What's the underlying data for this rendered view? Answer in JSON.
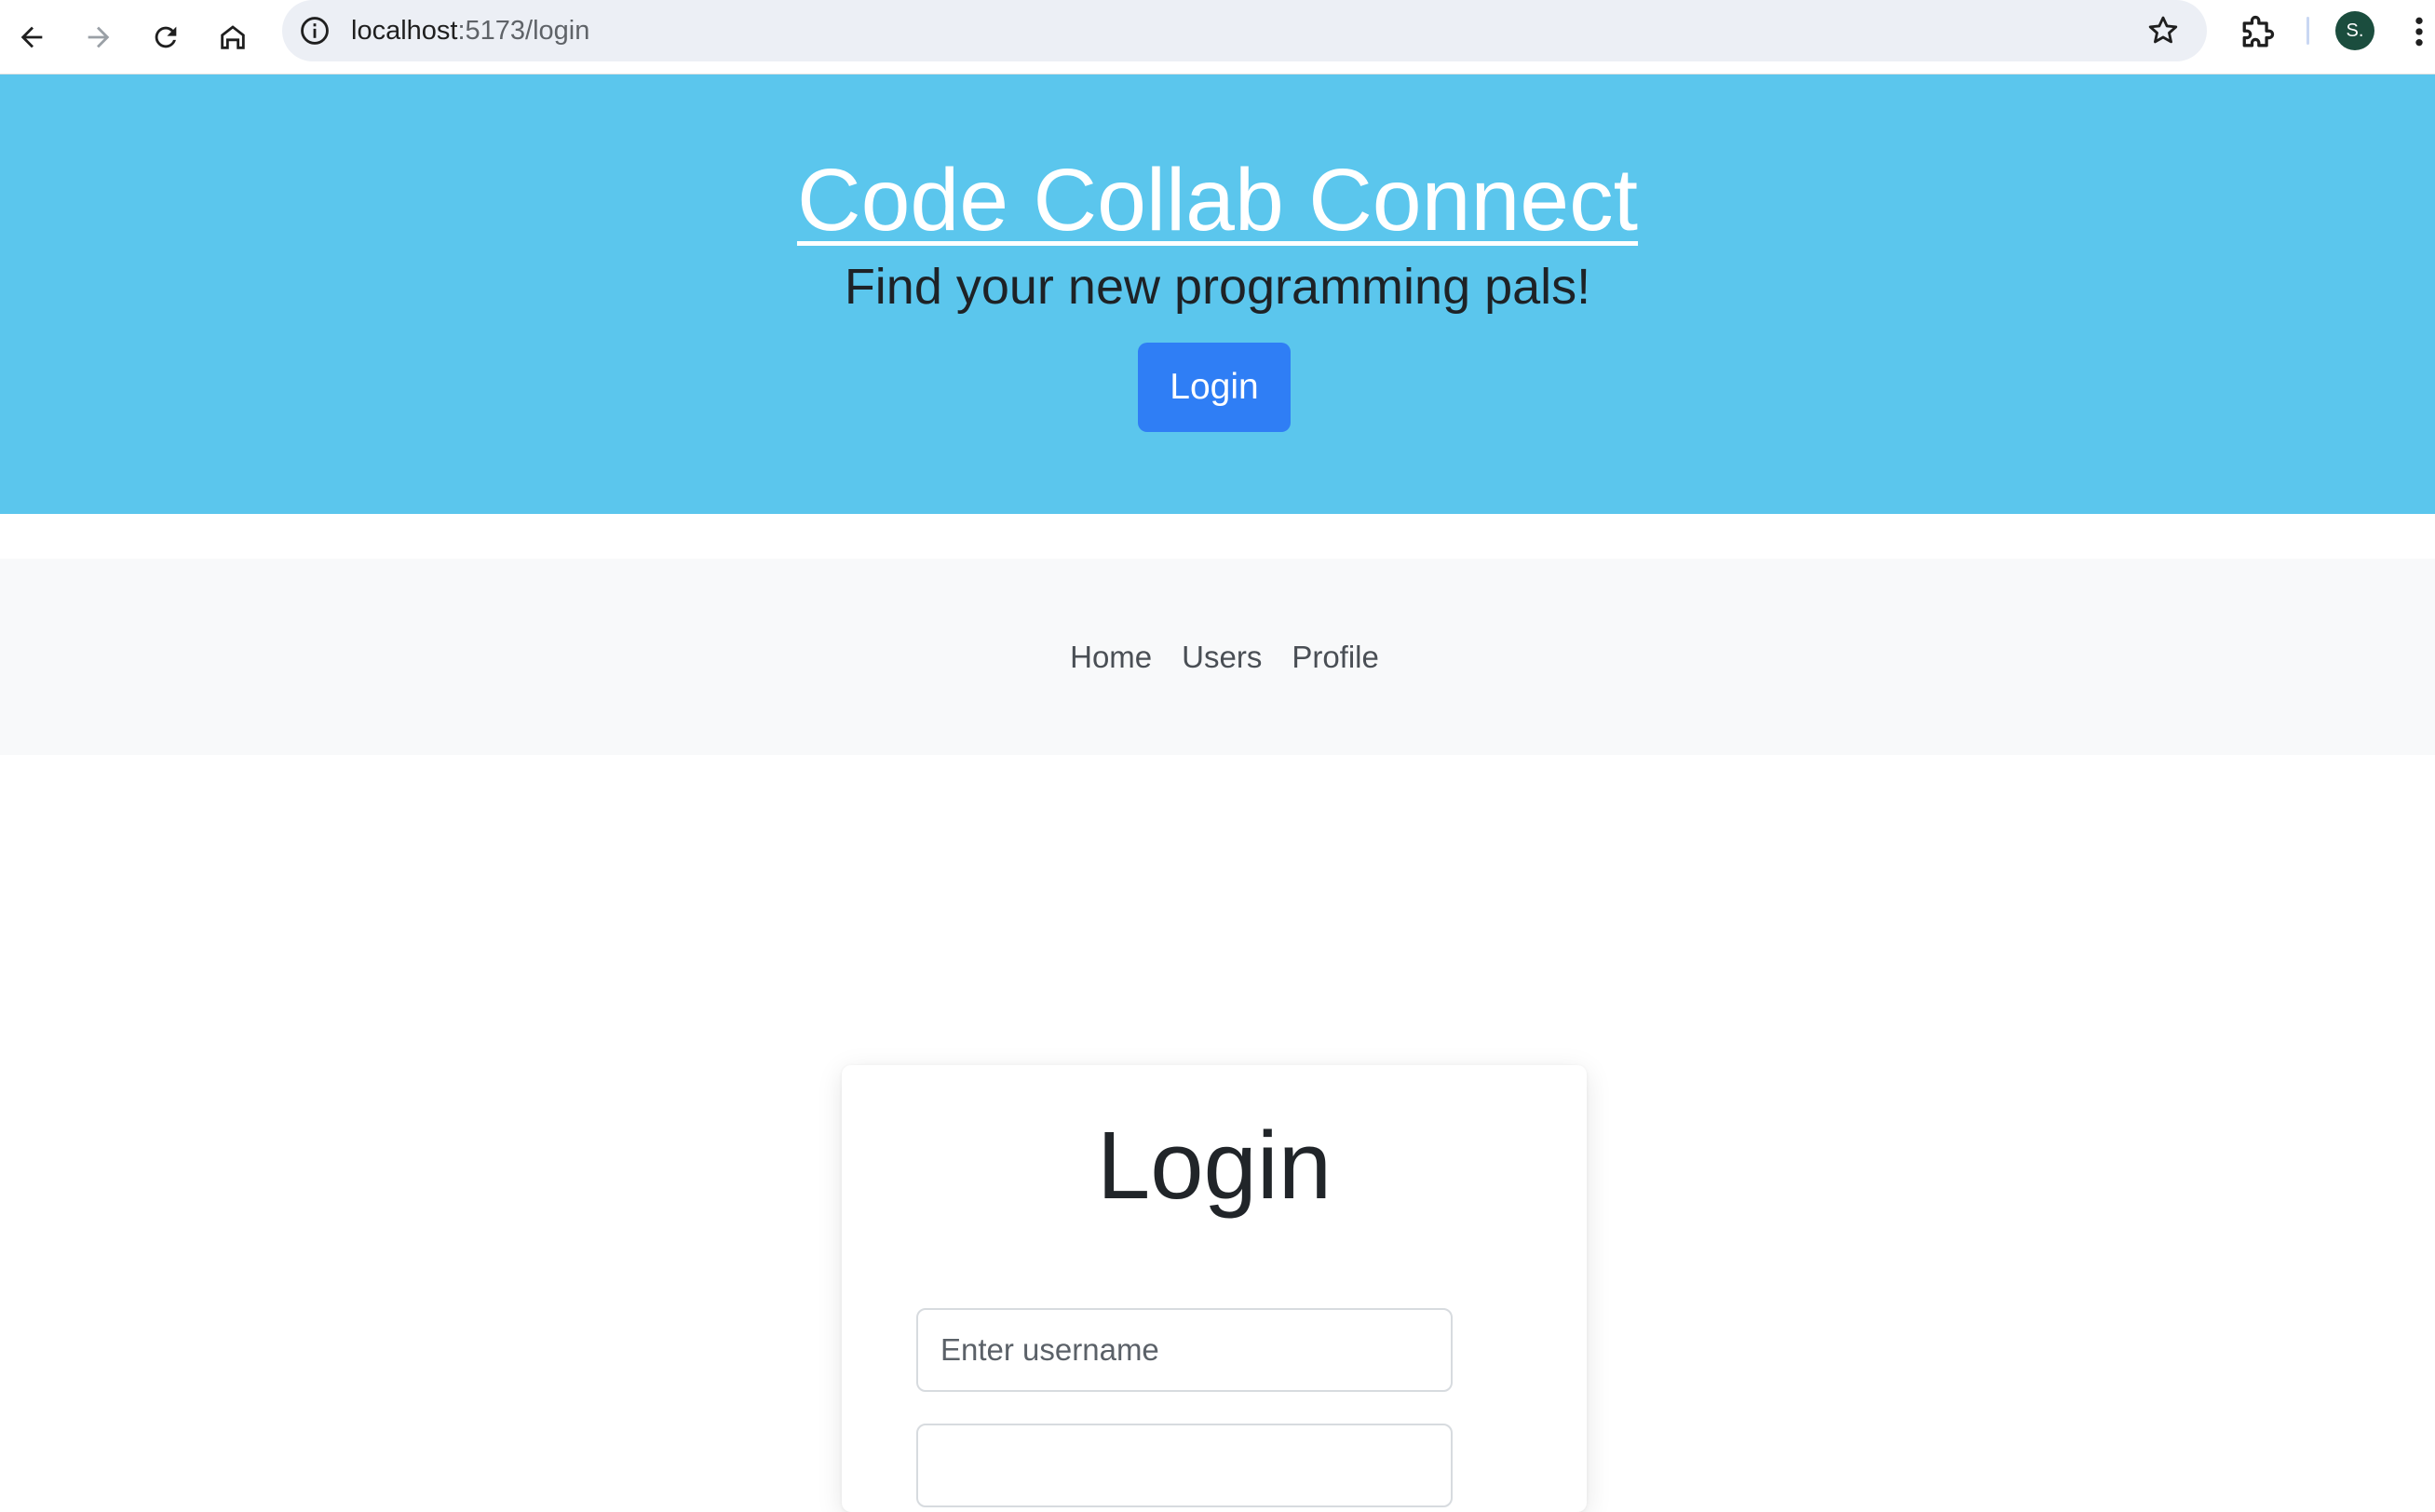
{
  "browser": {
    "url_host": "localhost",
    "url_path": ":5173/login",
    "profile_initial": "S."
  },
  "hero": {
    "title": "Code Collab Connect",
    "subtitle": "Find your new programming pals!",
    "login_label": "Login",
    "background_color": "#5bc6ed",
    "button_color": "#2f7ef5"
  },
  "nav": {
    "links": [
      {
        "label": "Home"
      },
      {
        "label": "Users"
      },
      {
        "label": "Profile"
      }
    ]
  },
  "login_card": {
    "title": "Login",
    "username_placeholder": "Enter username",
    "password_placeholder": ""
  },
  "icons": {
    "back": "back-arrow-icon",
    "forward": "forward-arrow-icon",
    "reload": "reload-icon",
    "home": "home-icon",
    "site_info": "info-icon",
    "bookmark": "star-icon",
    "extensions": "puzzle-icon",
    "menu": "kebab-menu-icon"
  }
}
